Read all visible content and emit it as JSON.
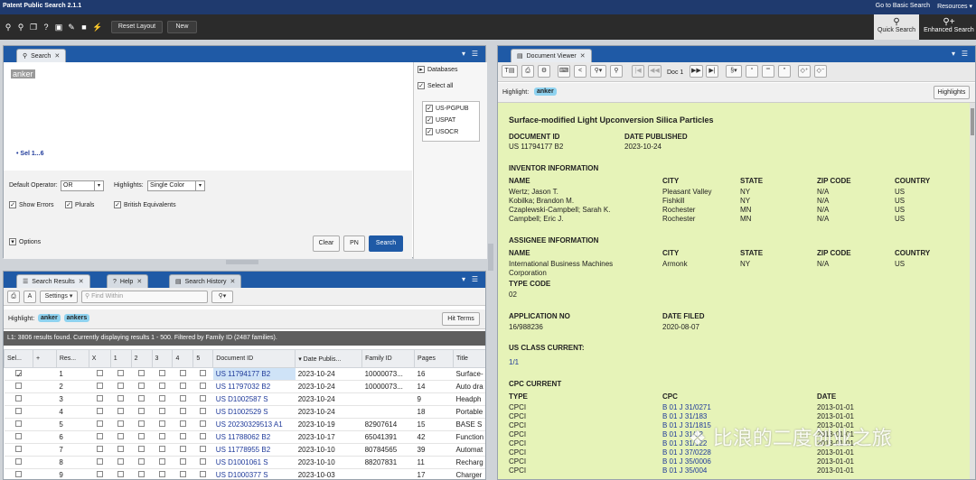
{
  "app": {
    "title": "Patent Public Search 2.1.1",
    "links": [
      "Go to Basic Search",
      "Resources ▾"
    ]
  },
  "toolbar": {
    "reset_layout": "Reset Layout",
    "new": "New",
    "quick_search": "Quick Search",
    "enhanced_search": "Enhanced Search"
  },
  "search": {
    "tab": "Search",
    "query": "anker",
    "sel_link": "• Sel 1...6",
    "default_operator_label": "Default Operator:",
    "default_operator": "OR",
    "highlights_label": "Highlights:",
    "highlights": "Single Color",
    "show_errors": "Show Errors",
    "plurals": "Plurals",
    "british": "British Equivalents",
    "options": "Options",
    "clear": "Clear",
    "pn": "PN",
    "search": "Search"
  },
  "databases": {
    "title": "Databases",
    "select_all": "Select all",
    "items": [
      "US-PGPUB",
      "USPAT",
      "USOCR"
    ]
  },
  "results": {
    "tabs": [
      "Search Results",
      "Help",
      "Search History"
    ],
    "settings": "Settings",
    "find_placeholder": "Find Within",
    "highlight_label": "Highlight:",
    "chips": [
      "anker",
      "ankers"
    ],
    "hit_terms": "Hit Terms",
    "status": "L1: 3806 results found. Currently displaying results 1 - 500. Filtered by Family ID (2487 families).",
    "columns": [
      "Sel...",
      "+",
      "Res...",
      "X",
      "1",
      "2",
      "3",
      "4",
      "5",
      "Document ID",
      "▾ Date Publis...",
      "Family ID",
      "Pages",
      "Title"
    ],
    "rows": [
      {
        "n": "1",
        "doc": "US 11794177 B2",
        "date": "2023-10-24",
        "fam": "10000073...",
        "pages": "16",
        "title": "Surface-",
        "sel": true
      },
      {
        "n": "2",
        "doc": "US 11797032 B2",
        "date": "2023-10-24",
        "fam": "10000073...",
        "pages": "14",
        "title": "Auto dra",
        "sel": false
      },
      {
        "n": "3",
        "doc": "US D1002587 S",
        "date": "2023-10-24",
        "fam": "",
        "pages": "9",
        "title": "Headph",
        "sel": false
      },
      {
        "n": "4",
        "doc": "US D1002529 S",
        "date": "2023-10-24",
        "fam": "",
        "pages": "18",
        "title": "Portable",
        "sel": false
      },
      {
        "n": "5",
        "doc": "US 20230329513 A1",
        "date": "2023-10-19",
        "fam": "82907614",
        "pages": "15",
        "title": "BASE S",
        "sel": false
      },
      {
        "n": "6",
        "doc": "US 11788062 B2",
        "date": "2023-10-17",
        "fam": "65041391",
        "pages": "42",
        "title": "Function",
        "sel": false
      },
      {
        "n": "7",
        "doc": "US 11778955 B2",
        "date": "2023-10-10",
        "fam": "80784565",
        "pages": "39",
        "title": "Automat",
        "sel": false
      },
      {
        "n": "8",
        "doc": "US D1001061 S",
        "date": "2023-10-10",
        "fam": "88207831",
        "pages": "11",
        "title": "Recharg",
        "sel": false
      },
      {
        "n": "9",
        "doc": "US D1000377 S",
        "date": "2023-10-03",
        "fam": "",
        "pages": "17",
        "title": "Charger",
        "sel": false
      }
    ]
  },
  "viewer": {
    "tab": "Document Viewer",
    "doc_label": "Doc 1",
    "highlight_label": "Highlight:",
    "chip": "anker",
    "highlights_btn": "Highlights",
    "title": "Surface-modified Light Upconversion Silica Particles",
    "document_id_label": "DOCUMENT ID",
    "document_id": "US 11794177 B2",
    "date_published_label": "DATE PUBLISHED",
    "date_published": "2023-10-24",
    "inventor_section": "INVENTOR INFORMATION",
    "col_name": "NAME",
    "col_city": "CITY",
    "col_state": "STATE",
    "col_zip": "ZIP CODE",
    "col_country": "COUNTRY",
    "inventors": [
      {
        "name": "Wertz; Jason T.",
        "city": "Pleasant Valley",
        "state": "NY",
        "zip": "N/A",
        "country": "US"
      },
      {
        "name": "Kobilka; Brandon M.",
        "city": "Fishkill",
        "state": "NY",
        "zip": "N/A",
        "country": "US"
      },
      {
        "name": "Czaplewski-Campbell; Sarah K.",
        "city": "Rochester",
        "state": "MN",
        "zip": "N/A",
        "country": "US"
      },
      {
        "name": "Campbell; Eric J.",
        "city": "Rochester",
        "state": "MN",
        "zip": "N/A",
        "country": "US"
      }
    ],
    "assignee_section": "ASSIGNEE INFORMATION",
    "assignee": {
      "name1": "International Business Machines",
      "name2": "Corporation",
      "city": "Armonk",
      "state": "NY",
      "zip": "N/A",
      "country": "US"
    },
    "type_code_label": "TYPE CODE",
    "type_code": "02",
    "application_no_label": "APPLICATION NO",
    "application_no": "16/988236",
    "date_filed_label": "DATE FILED",
    "date_filed": "2020-08-07",
    "us_class_label": "US CLASS CURRENT:",
    "us_class": "1/1",
    "cpc_section": "CPC CURRENT",
    "cpc_col_type": "TYPE",
    "cpc_col_cpc": "CPC",
    "cpc_col_date": "DATE",
    "cpc_rows": [
      {
        "type": "CPCI",
        "cpc": "B 01 J 31/0271",
        "date": "2013-01-01"
      },
      {
        "type": "CPCI",
        "cpc": "B 01 J 31/183",
        "date": "2013-01-01"
      },
      {
        "type": "CPCI",
        "cpc": "B 01 J 31/1815",
        "date": "2013-01-01"
      },
      {
        "type": "CPCI",
        "cpc": "B 01 J 31/12",
        "date": "2013-01-01"
      },
      {
        "type": "CPCI",
        "cpc": "B 01 J 31/122",
        "date": "2013-01-01"
      },
      {
        "type": "CPCI",
        "cpc": "B 01 J 37/0228",
        "date": "2013-01-01"
      },
      {
        "type": "CPCI",
        "cpc": "B 01 J 35/0006",
        "date": "2013-01-01"
      },
      {
        "type": "CPCI",
        "cpc": "B 01 J 35/004",
        "date": "2013-01-01"
      }
    ]
  },
  "watermark": "比浪的二度创业之旅"
}
